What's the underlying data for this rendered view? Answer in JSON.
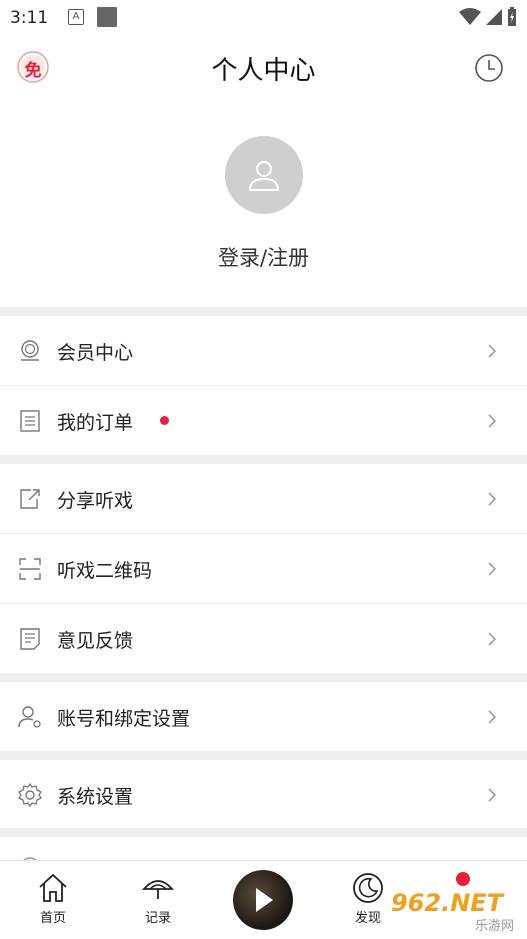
{
  "status": {
    "time": "3:11",
    "a_icon_letter": "A"
  },
  "header": {
    "title": "个人中心",
    "free_badge_text": "免"
  },
  "profile": {
    "login_label": "登录/注册"
  },
  "menu": {
    "vip": "会员中心",
    "orders": "我的订单",
    "share": "分享听戏",
    "qrcode": "听戏二维码",
    "feedback": "意见反馈",
    "account": "账号和绑定设置",
    "system": "系统设置"
  },
  "tabs": {
    "home": "首页",
    "records": "记录",
    "discover": "发现"
  },
  "watermark": {
    "text": "962.NET",
    "sub": "乐游网"
  },
  "colors": {
    "accent_red": "#e5203c",
    "separator": "#eeeeee",
    "avatar_bg": "#cfcfcf"
  }
}
